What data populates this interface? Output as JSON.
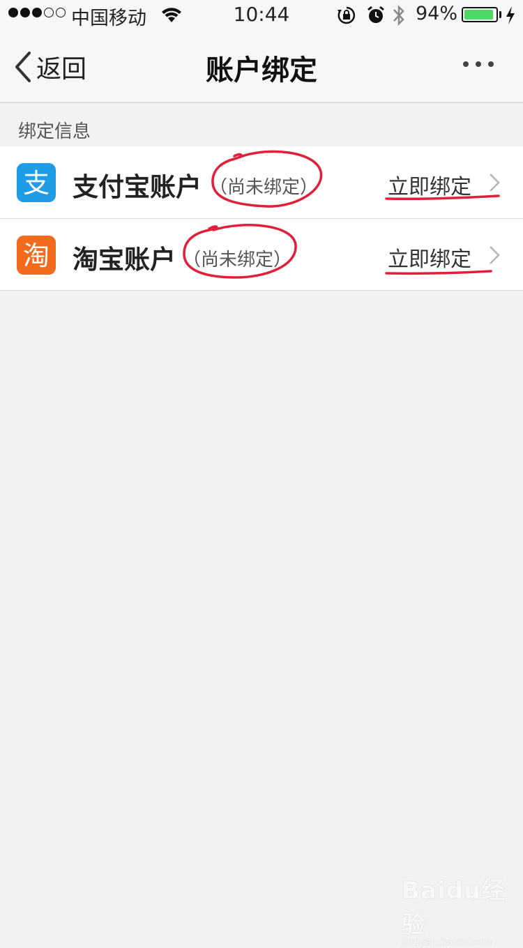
{
  "status_bar": {
    "carrier": "中国移动",
    "time": "10:44",
    "battery": "94%",
    "battery_level": 0.94,
    "signal_bars_filled": 3,
    "signal_bars_total": 5
  },
  "nav": {
    "back_label": "返回",
    "title": "账户绑定"
  },
  "section": {
    "title": "绑定信息"
  },
  "accounts": [
    {
      "name": "支付宝账户",
      "status": "（尚未绑定）",
      "action": "立即绑定",
      "icon": "alipay-icon",
      "icon_glyph": "支"
    },
    {
      "name": "淘宝账户",
      "status": "（尚未绑定）",
      "action": "立即绑定",
      "icon": "taobao-icon",
      "icon_glyph": "淘"
    }
  ],
  "watermark": {
    "logo": "Baidu经验",
    "url": "jingyan.baidu.com"
  },
  "colors": {
    "alipay": "#1f9ce6",
    "taobao": "#f26b1d",
    "annotation": "#e0203a",
    "battery": "#4cd964"
  }
}
